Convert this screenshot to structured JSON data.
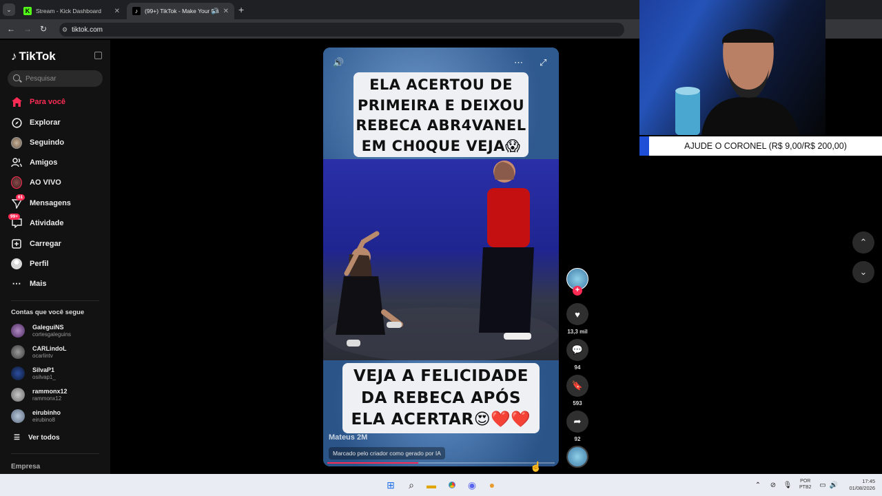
{
  "browser": {
    "tabs": [
      {
        "title": "Stream - Kick Dashboard"
      },
      {
        "title": "(99+) TikTok - Make Your Da"
      }
    ],
    "url": "tiktok.com"
  },
  "sidebar": {
    "logo": "TikTok",
    "search_placeholder": "Pesquisar",
    "nav": [
      {
        "label": "Para você",
        "icon": "home-icon"
      },
      {
        "label": "Explorar",
        "icon": "compass-icon"
      },
      {
        "label": "Seguindo",
        "icon": "following-avatar-icon"
      },
      {
        "label": "Amigos",
        "icon": "friends-icon"
      },
      {
        "label": "AO VIVO",
        "icon": "live-icon"
      },
      {
        "label": "Mensagens",
        "icon": "send-icon",
        "badge": "61"
      },
      {
        "label": "Atividade",
        "icon": "activity-icon",
        "badge": "99+"
      },
      {
        "label": "Carregar",
        "icon": "upload-icon"
      },
      {
        "label": "Perfil",
        "icon": "profile-avatar-icon"
      },
      {
        "label": "Mais",
        "icon": "more-icon"
      }
    ],
    "following_title": "Contas que você segue",
    "following": [
      {
        "name": "GaleguiNS",
        "handle": "cortesgaleguins"
      },
      {
        "name": "CARLindoL",
        "handle": "ocarlintv"
      },
      {
        "name": "SilvaP1",
        "handle": "osilvap1_"
      },
      {
        "name": "rammonx12",
        "handle": "rammonx12"
      },
      {
        "name": "eirubinho",
        "handle": "eirubino8"
      }
    ],
    "see_all": "Ver todos",
    "footer": "Empresa"
  },
  "video": {
    "caption_top": [
      "ELA ACERTOU DE",
      "PRIMEIRA E DEIXOU",
      "REBECA ABR4VANEL",
      "EM CH0QUE VEJA😱"
    ],
    "caption_bottom": [
      "VEJA A FELICIDADE",
      "DA REBECA APÓS",
      "ELA ACERTAR😍❤️❤️"
    ],
    "author_watermark": "Mateus 2M",
    "ai_label": "Marcado pelo criador como gerado por IA",
    "progress": 0.4
  },
  "actions": {
    "likes": "13,3 mil",
    "comments": "94",
    "saves": "593",
    "shares": "92"
  },
  "overlay": {
    "donation_text": "AJUDE O CORONEL (R$ 9,00/R$ 200,00)"
  },
  "taskbar": {
    "lang_top": "POR",
    "lang_bottom": "PTB2",
    "time": "17:45",
    "date": "01/08/2026"
  }
}
